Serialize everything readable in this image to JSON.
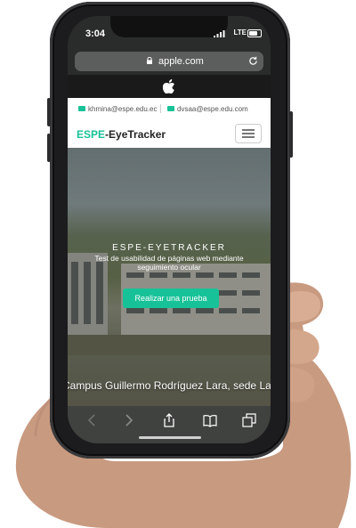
{
  "status": {
    "time": "3:04",
    "network": "LTE"
  },
  "browser": {
    "url": "apple.com"
  },
  "topbar": {
    "email_1": "khmina@espe.edu.ec",
    "email_2": "dvsaa@espe.edu.com"
  },
  "navbar": {
    "brand_accent": "ESPE",
    "brand_rest": "-EyeTracker"
  },
  "hero": {
    "title": "ESPE-EYETRACKER",
    "subtitle": "Test de usabilidad de páginas web mediante seguimiento ocular",
    "cta_label": "Realizar una prueba",
    "caption": "Campus Guillermo Rodríguez Lara, sede Latacunga"
  },
  "colors": {
    "accent": "#18c298",
    "phone_frame": "#1c1c1e"
  },
  "icons": [
    "lock-icon",
    "reload-icon",
    "apple-logo-icon",
    "mail-icon",
    "menu-icon",
    "back-icon",
    "forward-icon",
    "share-icon",
    "bookmarks-icon",
    "tabs-icon"
  ]
}
